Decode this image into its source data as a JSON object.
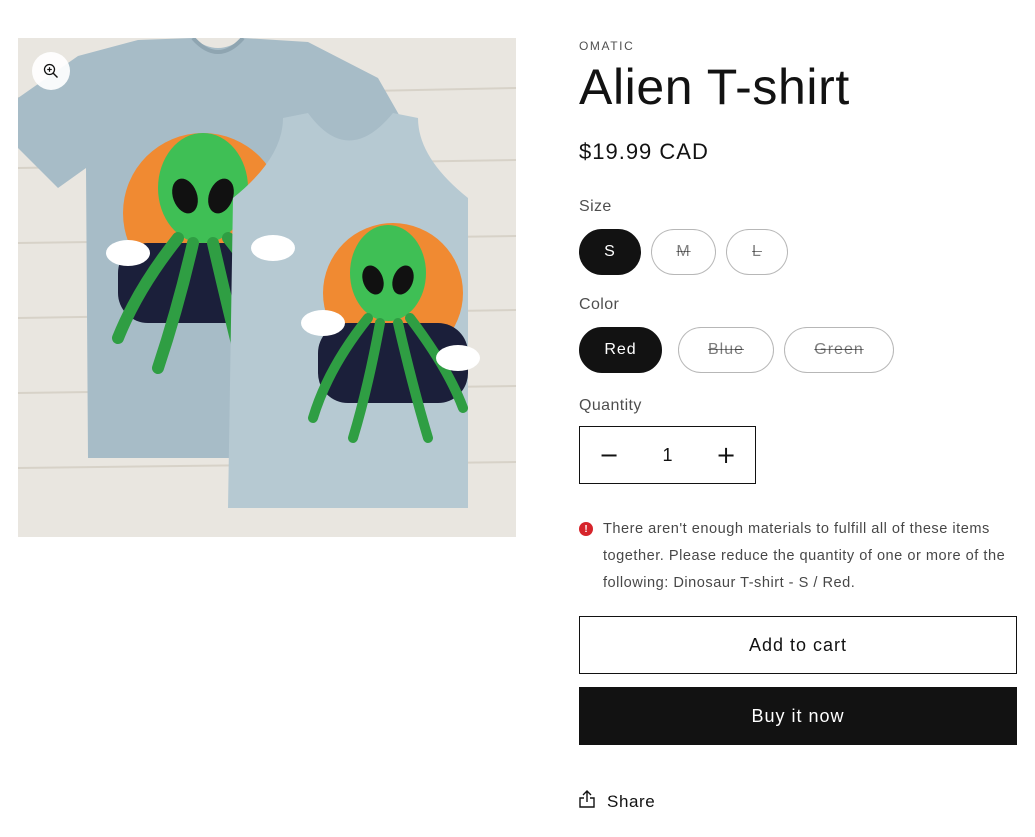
{
  "product": {
    "vendor": "OMATIC",
    "title": "Alien T-shirt",
    "price": "$19.99 CAD",
    "image_alt": "Alien T-shirt"
  },
  "options": {
    "size": {
      "label": "Size",
      "values": [
        {
          "label": "S",
          "state": "selected"
        },
        {
          "label": "M",
          "state": "unavailable"
        },
        {
          "label": "L",
          "state": "unavailable"
        }
      ]
    },
    "color": {
      "label": "Color",
      "values": [
        {
          "label": "Red",
          "state": "selected"
        },
        {
          "label": "Blue",
          "state": "unavailable"
        },
        {
          "label": "Green",
          "state": "unavailable"
        }
      ]
    }
  },
  "quantity": {
    "label": "Quantity",
    "value": "1",
    "decrease_icon": "minus-icon",
    "increase_icon": "plus-icon"
  },
  "error": {
    "icon": "error-icon",
    "message": "There aren't enough materials to fulfill all of these items together. Please reduce the quantity of one or more of the following: Dinosaur T-shirt - S / Red."
  },
  "actions": {
    "add_to_cart": "Add to cart",
    "buy_now": "Buy it now",
    "share": "Share"
  },
  "colors": {
    "text": "#121212",
    "error": "#d6242b",
    "shirt": "#a7bcc7",
    "alien": "#3fbf55",
    "sun": "#f08a32"
  }
}
